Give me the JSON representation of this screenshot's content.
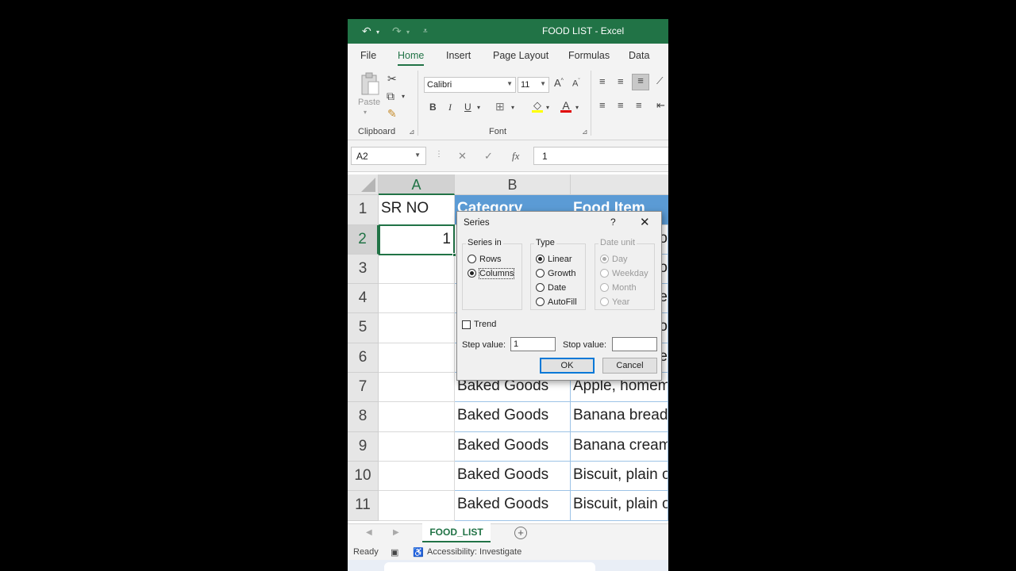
{
  "app": {
    "window_title": "FOOD LIST  -  Excel",
    "tabs": [
      "File",
      "Home",
      "Insert",
      "Page Layout",
      "Formulas",
      "Data"
    ],
    "active_tab": "Home"
  },
  "ribbon": {
    "clipboard_label": "Clipboard",
    "paste_label": "Paste",
    "font_label": "Font",
    "font_name": "Calibri",
    "font_size": "11",
    "bold": "B",
    "italic": "I",
    "underline": "U"
  },
  "formula_bar": {
    "name_box": "A2",
    "fx": "fx",
    "value": "1"
  },
  "grid": {
    "columns": [
      "A",
      "B"
    ],
    "header_row": {
      "a": "SR NO",
      "b": "Category",
      "c": "Food Item"
    },
    "row_numbers": [
      "1",
      "2",
      "3",
      "4",
      "5",
      "6",
      "7",
      "8",
      "9",
      "10",
      "11"
    ],
    "a2_value": "1",
    "visible_rows": [
      {
        "category": "Baked Goods",
        "item": "Apple, homem"
      },
      {
        "category": "Baked Goods",
        "item": "Banana bread"
      },
      {
        "category": "Baked Goods",
        "item": "Banana cream"
      },
      {
        "category": "Baked Goods",
        "item": "Biscuit, plain o"
      },
      {
        "category": "Baked Goods",
        "item": "Biscuit, plain o"
      }
    ],
    "right_edge_fragments": [
      "o",
      "o",
      "e",
      "o",
      "e"
    ]
  },
  "sheet": {
    "active_sheet": "FOOD_LIST",
    "add_sheet": "+"
  },
  "status": {
    "ready": "Ready",
    "accessibility": "Accessibility: Investigate"
  },
  "dialog": {
    "title": "Series",
    "help": "?",
    "close": "✕",
    "series_in_label": "Series in",
    "series_in_options": [
      {
        "label": "Rows",
        "selected": false
      },
      {
        "label": "Columns",
        "selected": true
      }
    ],
    "type_label": "Type",
    "type_options": [
      {
        "label": "Linear",
        "selected": true
      },
      {
        "label": "Growth",
        "selected": false
      },
      {
        "label": "Date",
        "selected": false
      },
      {
        "label": "AutoFill",
        "selected": false
      }
    ],
    "date_unit_label": "Date unit",
    "date_unit_options": [
      {
        "label": "Day",
        "selected": true
      },
      {
        "label": "Weekday",
        "selected": false
      },
      {
        "label": "Month",
        "selected": false
      },
      {
        "label": "Year",
        "selected": false
      }
    ],
    "trend_label": "Trend",
    "trend_checked": false,
    "step_value_label": "Step value:",
    "step_value": "1",
    "stop_value_label": "Stop value:",
    "stop_value": "",
    "ok_label": "OK",
    "cancel_label": "Cancel"
  },
  "colors": {
    "excel_green": "#217346",
    "table_header_blue": "#5b9bd5",
    "dialog_bg": "#f0f0f0"
  }
}
